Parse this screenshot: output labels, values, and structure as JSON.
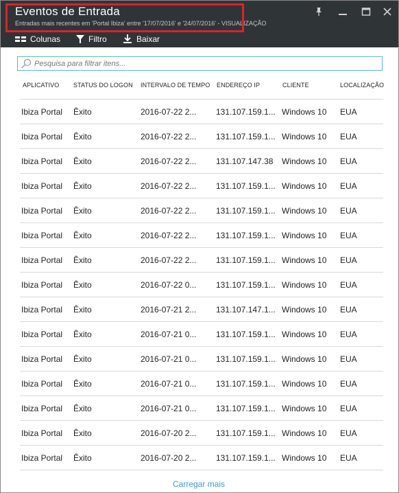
{
  "header": {
    "title": "Eventos de Entrada",
    "subtitle": "Entradas mais recentes em 'Portal Ibiza' entre '17/07/2016' e '24/07/2016' - VISUALIZAÇÃO"
  },
  "toolbar": {
    "columns_label": "Colunas",
    "filter_label": "Filtro",
    "download_label": "Baixar"
  },
  "search": {
    "placeholder": "Pesquisa para filtrar itens...",
    "value": ""
  },
  "table": {
    "columns": [
      "APLICATIVO",
      "STATUS DO LOGON",
      "INTERVALO DE TEMPO",
      "ENDEREÇO IP",
      "CLIENTE",
      "LOCALIZAÇÃO"
    ],
    "rows": [
      [
        "Ibiza Portal",
        "Êxito",
        "2016-07-22 2...",
        "131.107.159.1...",
        "Windows 10",
        "EUA"
      ],
      [
        "Ibiza Portal",
        "Êxito",
        "2016-07-22 2...",
        "131.107.159.1...",
        "Windows 10",
        "EUA"
      ],
      [
        "Ibiza Portal",
        "Êxito",
        "2016-07-22 2...",
        "131.107.147.38",
        "Windows 10",
        "EUA"
      ],
      [
        "Ibiza Portal",
        "Êxito",
        "2016-07-22 2...",
        "131.107.159.1...",
        "Windows 10",
        "EUA"
      ],
      [
        "Ibiza Portal",
        "Êxito",
        "2016-07-22 2...",
        "131.107.159.1...",
        "Windows 10",
        "EUA"
      ],
      [
        "Ibiza Portal",
        "Êxito",
        "2016-07-22 2...",
        "131.107.159.1...",
        "Windows 10",
        "EUA"
      ],
      [
        "Ibiza Portal",
        "Êxito",
        "2016-07-22 2...",
        "131.107.159.1...",
        "Windows 10",
        "EUA"
      ],
      [
        "Ibiza Portal",
        "Êxito",
        "2016-07-22 0...",
        "131.107.159.1...",
        "Windows 10",
        "EUA"
      ],
      [
        "Ibiza Portal",
        "Êxito",
        "2016-07-21 2...",
        "131.107.147.1...",
        "Windows 10",
        "EUA"
      ],
      [
        "Ibiza Portal",
        "Êxito",
        "2016-07-21 0...",
        "131.107.159.1...",
        "Windows 10",
        "EUA"
      ],
      [
        "Ibiza Portal",
        "Êxito",
        "2016-07-21 0...",
        "131.107.159.1...",
        "Windows 10",
        "EUA"
      ],
      [
        "Ibiza Portal",
        "Êxito",
        "2016-07-21 0...",
        "131.107.159.1...",
        "Windows 10",
        "EUA"
      ],
      [
        "Ibiza Portal",
        "Êxito",
        "2016-07-21 0...",
        "131.107.159.1...",
        "Windows 10",
        "EUA"
      ],
      [
        "Ibiza Portal",
        "Êxito",
        "2016-07-20 2...",
        "131.107.159.1...",
        "Windows 10",
        "EUA"
      ],
      [
        "Ibiza Portal",
        "Êxito",
        "2016-07-20 2...",
        "131.107.159.1...",
        "Windows 10",
        "EUA"
      ]
    ]
  },
  "footer": {
    "load_more_label": "Carregar mais"
  },
  "colors": {
    "header_bg": "#2f3437",
    "highlight": "#e0202a",
    "accent": "#3a9bd6"
  }
}
